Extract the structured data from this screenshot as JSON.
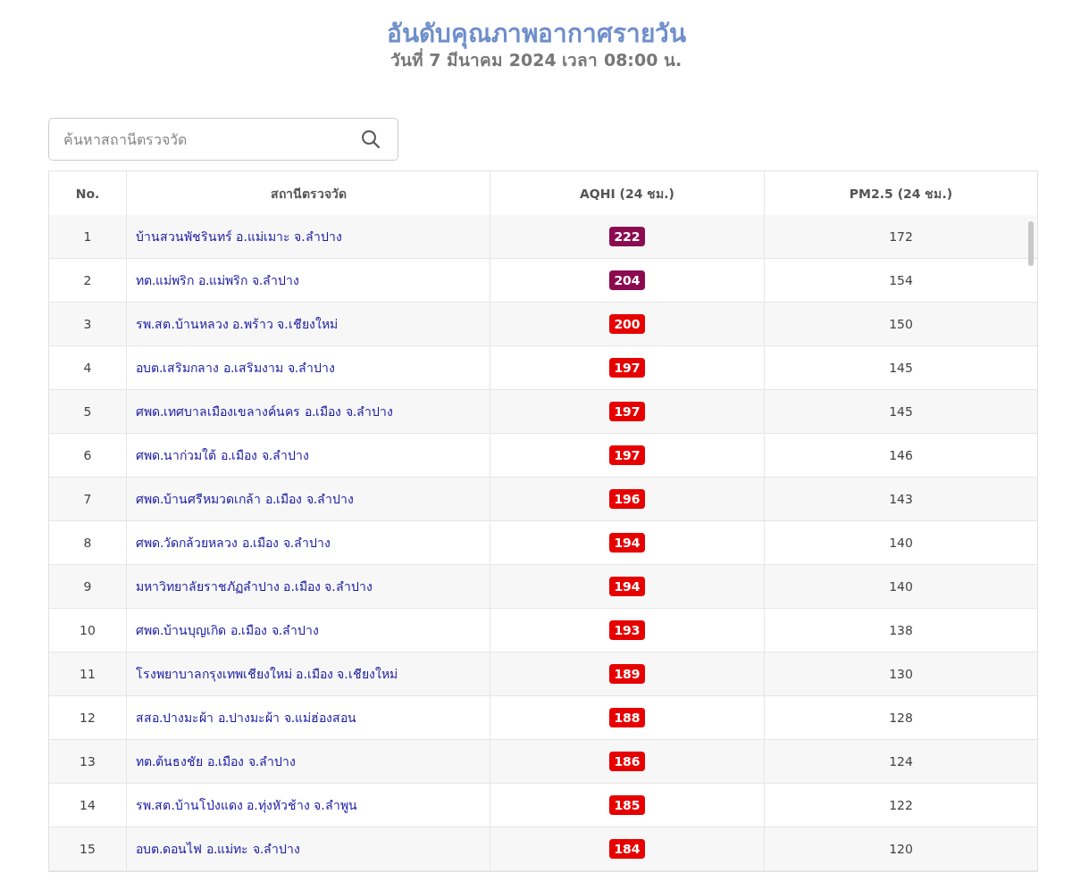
{
  "title": "อันดับคุณภาพอากาศรายวัน",
  "subtitle": "วันที่ 7 มีนาคม 2024 เวลา 08:00 น.",
  "search": {
    "placeholder": "ค้นหาสถานีตรวจวัด"
  },
  "table": {
    "columns": [
      "No.",
      "สถานีตรวจวัด",
      "AQHI (24 ชม.)",
      "PM2.5 (24 ชม.)"
    ],
    "rows": [
      {
        "no": "1",
        "station": "บ้านสวนพัชรินทร์ อ.แม่เมาะ จ.ลำปาง",
        "aqhi": "222",
        "color": "#8b0a50",
        "pm25": "172"
      },
      {
        "no": "2",
        "station": "ทต.แม่พริก อ.แม่พริก จ.ลำปาง",
        "aqhi": "204",
        "color": "#8b0a50",
        "pm25": "154"
      },
      {
        "no": "3",
        "station": "รพ.สต.บ้านหลวง อ.พร้าว จ.เชียงใหม่",
        "aqhi": "200",
        "color": "#e60000",
        "pm25": "150"
      },
      {
        "no": "4",
        "station": "อบต.เสริมกลาง อ.เสริมงาม จ.ลำปาง",
        "aqhi": "197",
        "color": "#e60000",
        "pm25": "145"
      },
      {
        "no": "5",
        "station": "ศพด.เทศบาลเมืองเขลางค์นคร อ.เมือง จ.ลำปาง",
        "aqhi": "197",
        "color": "#e60000",
        "pm25": "145"
      },
      {
        "no": "6",
        "station": "ศพด.นาก่วมใต้ อ.เมือง จ.ลำปาง",
        "aqhi": "197",
        "color": "#e60000",
        "pm25": "146"
      },
      {
        "no": "7",
        "station": "ศพด.บ้านศรีหมวดเกล้า อ.เมือง จ.ลำปาง",
        "aqhi": "196",
        "color": "#e60000",
        "pm25": "143"
      },
      {
        "no": "8",
        "station": "ศพด.วัดกล้วยหลวง อ.เมือง จ.ลำปาง",
        "aqhi": "194",
        "color": "#e60000",
        "pm25": "140"
      },
      {
        "no": "9",
        "station": "มหาวิทยาลัยราชภัฏลำปาง อ.เมือง จ.ลำปาง",
        "aqhi": "194",
        "color": "#e60000",
        "pm25": "140"
      },
      {
        "no": "10",
        "station": "ศพด.บ้านบุญเกิด อ.เมือง จ.ลำปาง",
        "aqhi": "193",
        "color": "#e60000",
        "pm25": "138"
      },
      {
        "no": "11",
        "station": "โรงพยาบาลกรุงเทพเชียงใหม่ อ.เมือง จ.เชียงใหม่",
        "aqhi": "189",
        "color": "#e60000",
        "pm25": "130"
      },
      {
        "no": "12",
        "station": "สสอ.ปางมะผ้า อ.ปางมะผ้า จ.แม่ฮ่องสอน",
        "aqhi": "188",
        "color": "#e60000",
        "pm25": "128"
      },
      {
        "no": "13",
        "station": "ทต.ต้นธงชัย อ.เมือง จ.ลำปาง",
        "aqhi": "186",
        "color": "#e60000",
        "pm25": "124"
      },
      {
        "no": "14",
        "station": "รพ.สต.บ้านโป่งแดง อ.ทุ่งหัวช้าง จ.ลำพูน",
        "aqhi": "185",
        "color": "#e60000",
        "pm25": "122"
      },
      {
        "no": "15",
        "station": "อบต.ดอนไฟ อ.แม่ทะ จ.ลำปาง",
        "aqhi": "184",
        "color": "#e60000",
        "pm25": "120"
      }
    ]
  }
}
